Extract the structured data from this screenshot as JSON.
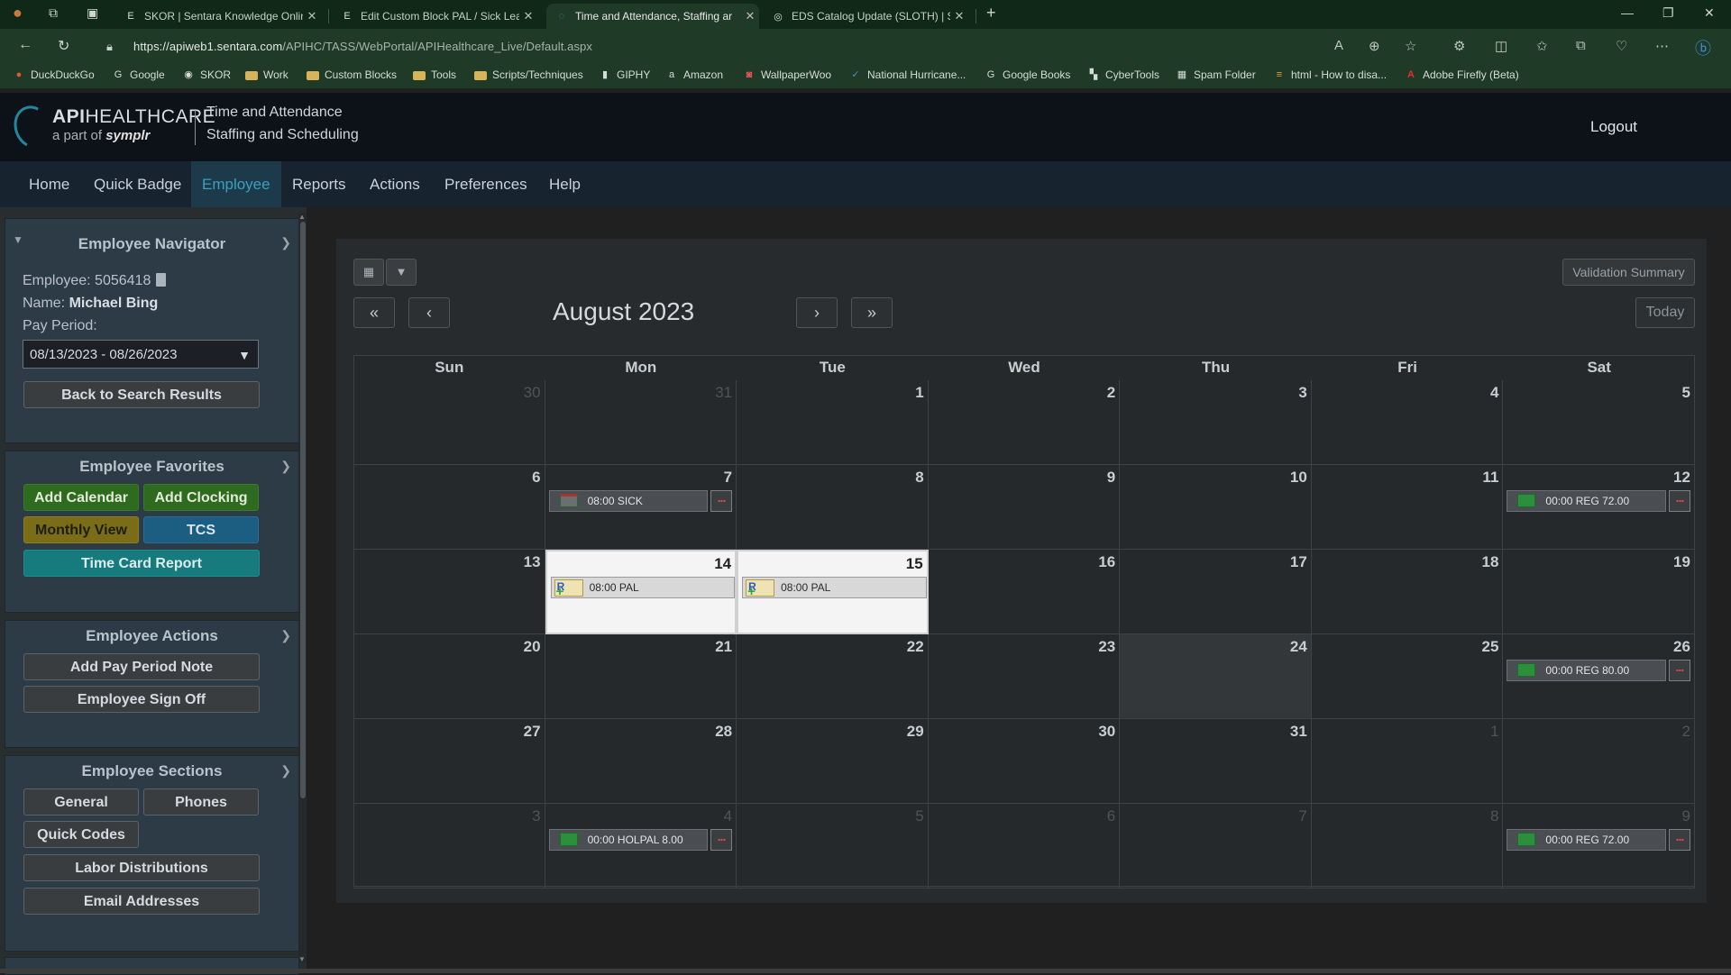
{
  "browser": {
    "tabs": [
      {
        "title": "SKOR | Sentara Knowledge Onlin",
        "icon": "E"
      },
      {
        "title": "Edit Custom Block PAL / Sick Lea",
        "icon": "E"
      },
      {
        "title": "Time and Attendance, Staffing ar",
        "icon": "◌"
      },
      {
        "title": "EDS Catalog Update (SLOTH) | Sl",
        "icon": "◎"
      }
    ],
    "url_host": "https://apiweb1.sentara.com",
    "url_path": "/APIHC/TASS/WebPortal/APIHealthcare_Live/Default.aspx",
    "bookmarks": [
      "DuckDuckGo",
      "Google",
      "SKOR",
      "Work",
      "Custom Blocks",
      "Tools",
      "Scripts/Techniques",
      "GIPHY",
      "Amazon",
      "WallpaperWoo",
      "National Hurricane...",
      "Google Books",
      "CyberTools",
      "Spam Folder",
      "html - How to disa...",
      "Adobe Firefly (Beta)"
    ]
  },
  "app": {
    "logo_api": "API",
    "logo_healthcare": "HEALTHCARE",
    "logo_sub_prefix": "a part of ",
    "logo_sub_brand": "symplr",
    "product_line1": "Time and Attendance",
    "product_line2": "Staffing and Scheduling",
    "logout": "Logout"
  },
  "menu": [
    "Home",
    "Quick Badge",
    "Employee",
    "Reports",
    "Actions",
    "Preferences",
    "Help"
  ],
  "sidebar": {
    "navigator": {
      "title": "Employee Navigator",
      "employee_label": "Employee:",
      "employee_id": "5056418",
      "name_label": "Name:",
      "name": "Michael Bing",
      "pay_period_label": "Pay Period:",
      "pay_period": "08/13/2023 - 08/26/2023",
      "back_button": "Back to Search Results"
    },
    "favorites": {
      "title": "Employee Favorites",
      "add_calendar": "Add Calendar",
      "add_clocking": "Add Clocking",
      "monthly_view": "Monthly View",
      "tcs": "TCS",
      "time_card_report": "Time Card Report"
    },
    "actions": {
      "title": "Employee Actions",
      "add_note": "Add Pay Period Note",
      "sign_off": "Employee Sign Off"
    },
    "sections": {
      "title": "Employee Sections",
      "general": "General",
      "phones": "Phones",
      "quick_codes": "Quick Codes",
      "labor": "Labor Distributions",
      "email": "Email Addresses"
    }
  },
  "calendar": {
    "validation_summary": "Validation Summary",
    "month_title": "August 2023",
    "today_button": "Today",
    "nav": {
      "first": "«",
      "prev": "‹",
      "next": "›",
      "last": "»"
    },
    "weekdays": [
      "Sun",
      "Mon",
      "Tue",
      "Wed",
      "Thu",
      "Fri",
      "Sat"
    ],
    "weeks": [
      [
        {
          "d": "30",
          "other": true
        },
        {
          "d": "31",
          "other": true
        },
        {
          "d": "1"
        },
        {
          "d": "2"
        },
        {
          "d": "3"
        },
        {
          "d": "4"
        },
        {
          "d": "5"
        }
      ],
      [
        {
          "d": "6"
        },
        {
          "d": "7",
          "event": "08:00 SICK",
          "kind": "sick",
          "more": "..."
        },
        {
          "d": "8"
        },
        {
          "d": "9"
        },
        {
          "d": "10"
        },
        {
          "d": "11"
        },
        {
          "d": "12",
          "event": "00:00 REG 72.00",
          "kind": "reg",
          "more": "..."
        }
      ],
      [
        {
          "d": "13"
        },
        {
          "d": "14",
          "event": "08:00 PAL",
          "kind": "pal",
          "highlight": true
        },
        {
          "d": "15",
          "event": "08:00 PAL",
          "kind": "pal",
          "highlight": true
        },
        {
          "d": "16"
        },
        {
          "d": "17"
        },
        {
          "d": "18"
        },
        {
          "d": "19"
        }
      ],
      [
        {
          "d": "20"
        },
        {
          "d": "21"
        },
        {
          "d": "22"
        },
        {
          "d": "23"
        },
        {
          "d": "24",
          "today": true
        },
        {
          "d": "25"
        },
        {
          "d": "26",
          "event": "00:00 REG 80.00",
          "kind": "reg",
          "more": "..."
        }
      ],
      [
        {
          "d": "27"
        },
        {
          "d": "28"
        },
        {
          "d": "29"
        },
        {
          "d": "30"
        },
        {
          "d": "31"
        },
        {
          "d": "1",
          "other": true
        },
        {
          "d": "2",
          "other": true
        }
      ],
      [
        {
          "d": "3",
          "other": true
        },
        {
          "d": "4",
          "other": true,
          "event": "00:00 HOLPAL 8.00",
          "kind": "reg",
          "more": "..."
        },
        {
          "d": "5",
          "other": true
        },
        {
          "d": "6",
          "other": true
        },
        {
          "d": "7",
          "other": true
        },
        {
          "d": "8",
          "other": true
        },
        {
          "d": "9",
          "other": true,
          "event": "00:00 REG 72.00",
          "kind": "reg",
          "more": "..."
        }
      ]
    ]
  },
  "colors": {
    "accent": "#3a9fc0",
    "header_bg": "#0c1217",
    "menu_bg": "#17232f",
    "panel_bg": "#2d3b46",
    "green_button": "#2f6b1f",
    "yellow_button": "#7b6d17",
    "blue_button": "#1c5d82",
    "teal_button": "#177b7d"
  }
}
